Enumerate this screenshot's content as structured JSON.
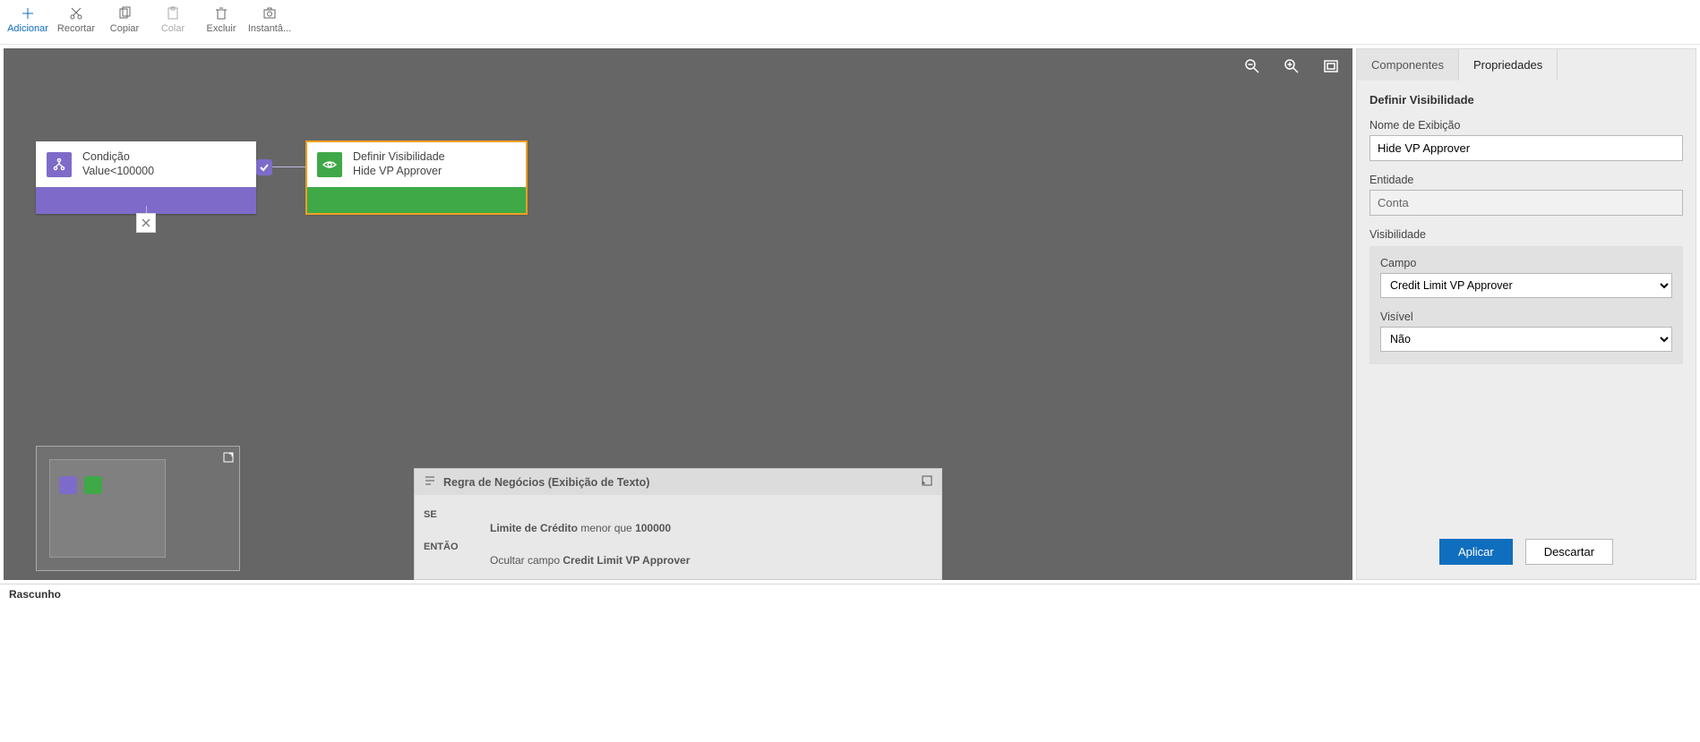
{
  "toolbar": {
    "add": {
      "label": "Adicionar"
    },
    "cut": {
      "label": "Recortar"
    },
    "copy": {
      "label": "Copiar"
    },
    "paste": {
      "label": "Colar"
    },
    "delete": {
      "label": "Excluir"
    },
    "snap": {
      "label": "Instantâ..."
    }
  },
  "canvas": {
    "condition": {
      "title": "Condição",
      "subtitle": "Value<100000"
    },
    "visibility": {
      "title": "Definir Visibilidade",
      "subtitle": "Hide VP Approver"
    }
  },
  "textPane": {
    "header": "Regra de Negócios (Exibição de Texto)",
    "if_kw": "SE",
    "if_text_pre": "Limite de Crédito",
    "if_text_mid": " menor que ",
    "if_text_val": "100000",
    "then_kw": "ENTÃO",
    "then_text_pre": "Ocultar campo ",
    "then_text_val": "Credit Limit VP Approver"
  },
  "side": {
    "tab_components": "Componentes",
    "tab_properties": "Propriedades",
    "heading": "Definir Visibilidade",
    "displayName_label": "Nome de Exibição",
    "displayName_value": "Hide VP Approver",
    "entity_label": "Entidade",
    "entity_value": "Conta",
    "visibility_label": "Visibilidade",
    "field_label": "Campo",
    "field_value": "Credit Limit VP Approver",
    "visible_label": "Visível",
    "visible_value": "Não",
    "apply": "Aplicar",
    "discard": "Descartar"
  },
  "status": "Rascunho"
}
